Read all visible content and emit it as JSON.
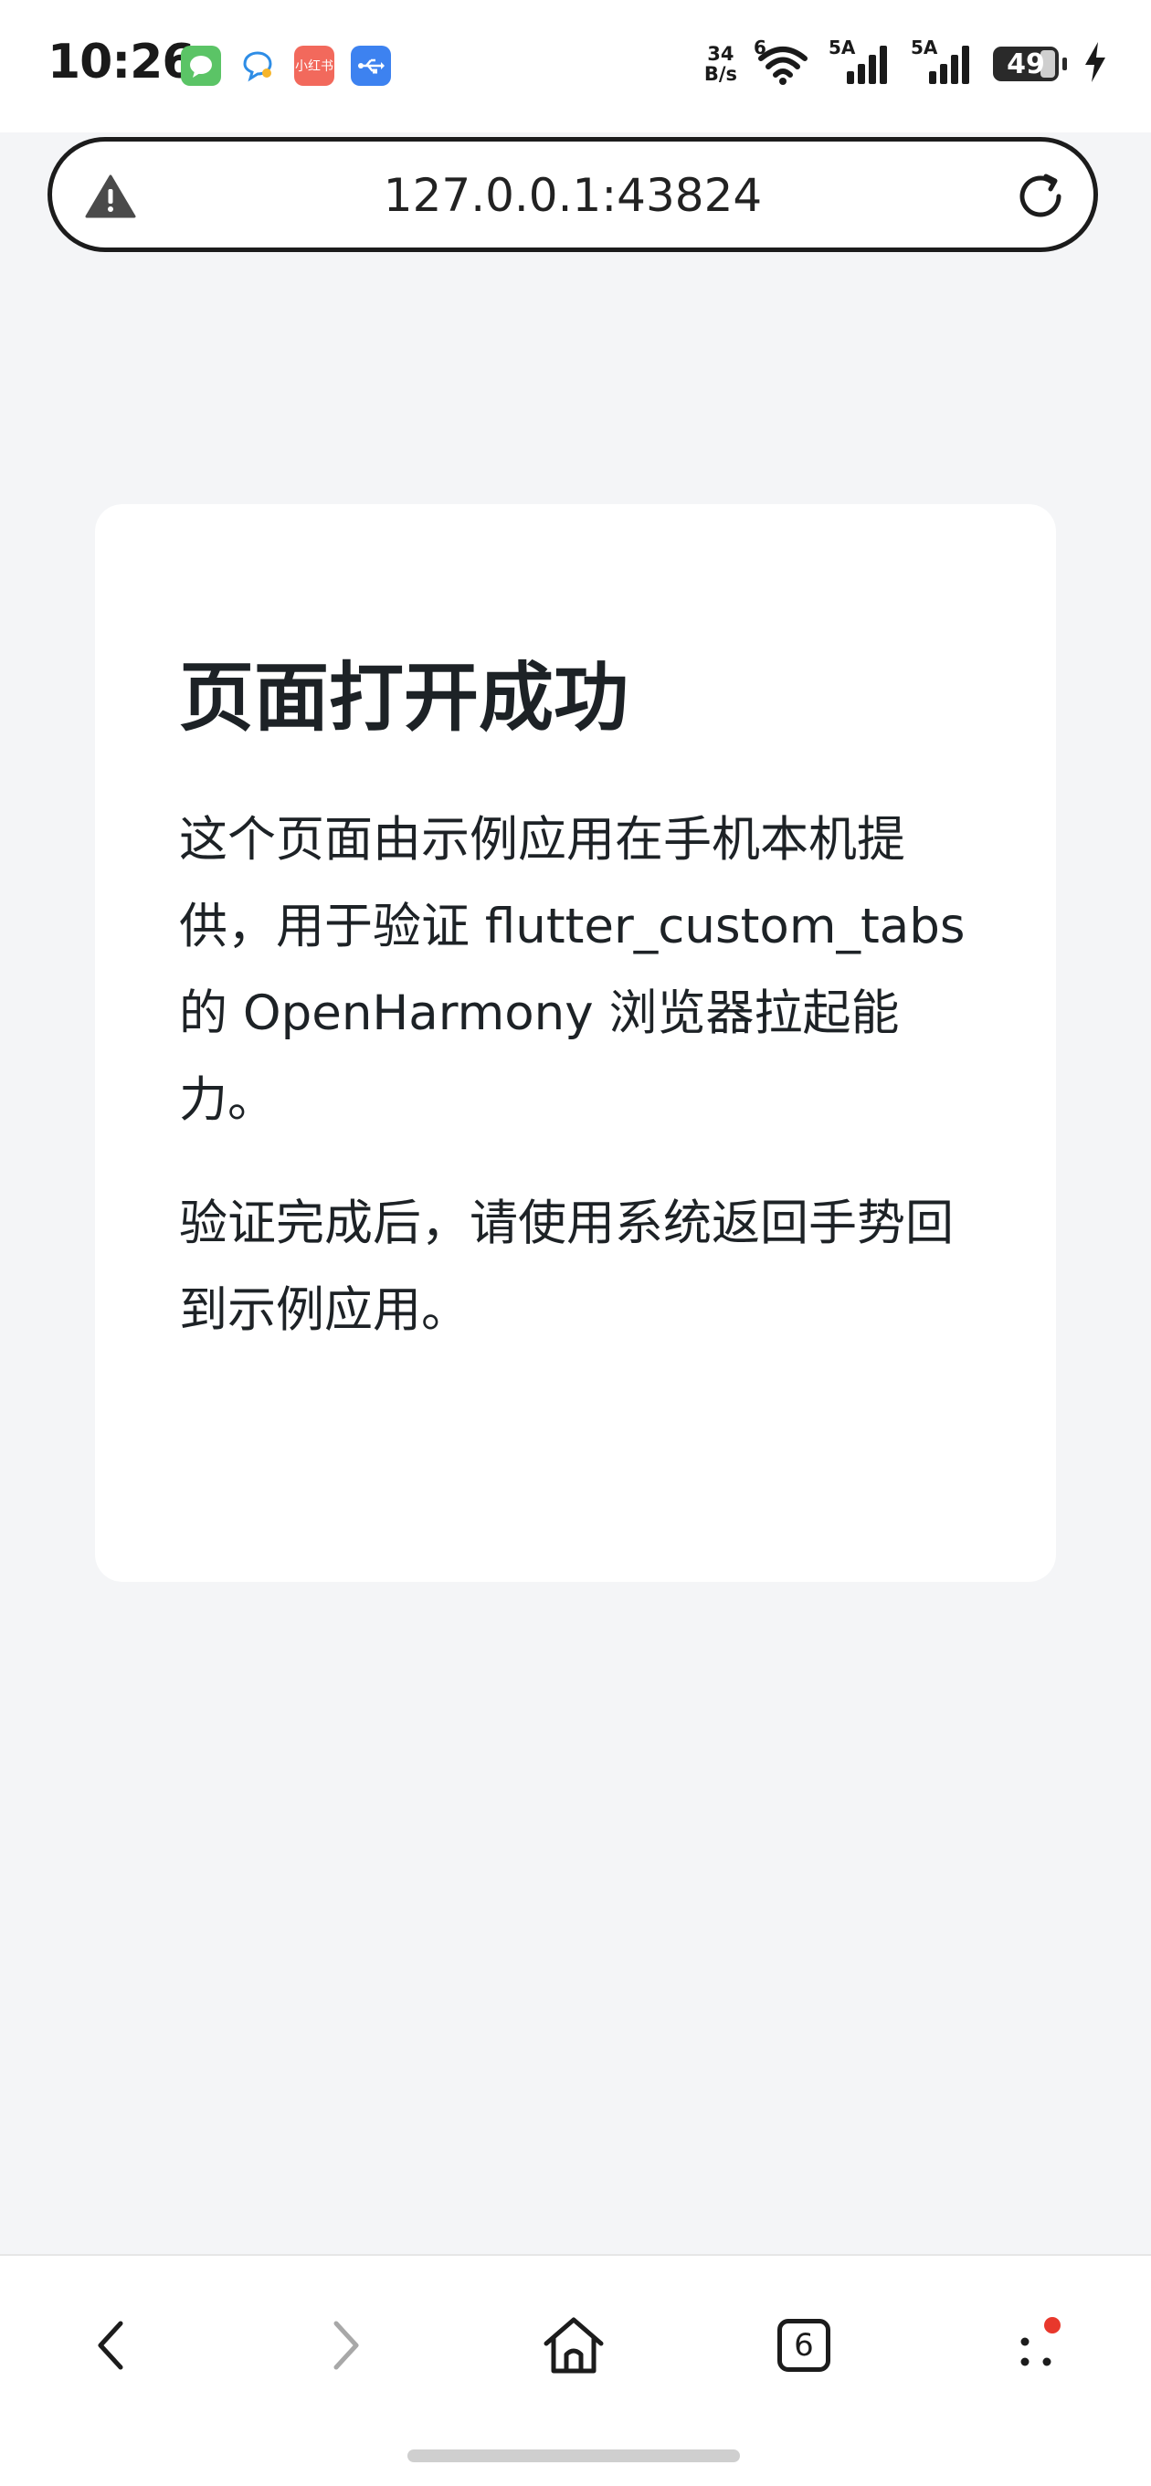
{
  "status_bar": {
    "time": "10:26",
    "notifications": [
      {
        "icon": "messages-app-icon",
        "color": "#5bc466",
        "label": ""
      },
      {
        "icon": "chat-bubble-icon",
        "color": "#ffffff",
        "label": ""
      },
      {
        "icon": "xiaohongshu-app-icon",
        "color": "#f2695c",
        "label": "小红书"
      },
      {
        "icon": "usb-icon",
        "color": "#3d82f0",
        "label": ""
      }
    ],
    "net_speed_value": "34",
    "net_speed_unit": "B/s",
    "wifi_label": "6",
    "signal1_label": "5A",
    "signal2_label": "5A",
    "battery_level": "49"
  },
  "browser": {
    "url": "127.0.0.1:43824",
    "tab_count": "6"
  },
  "page": {
    "title": "页面打开成功",
    "paragraphs": [
      "这个页面由示例应用在手机本机提供，用于验证 flutter_custom_tabs 的 OpenHarmony 浏览器拉起能力。",
      "验证完成后，请使用系统返回手势回到示例应用。"
    ]
  },
  "colors": {
    "page_background": "#f4f5f7",
    "card_background": "#ffffff",
    "text": "#1d2226",
    "badge_red": "#e8382c"
  }
}
